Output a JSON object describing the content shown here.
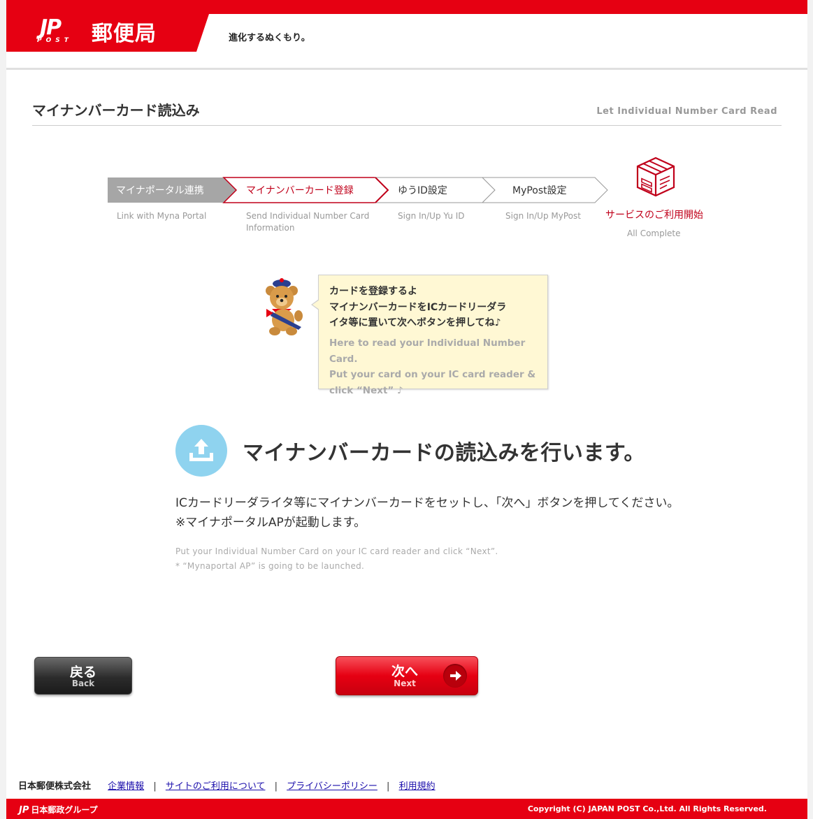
{
  "header": {
    "logo_jp": "JP",
    "logo_post": "POST",
    "brand": "郵便局",
    "tagline": "進化するぬくもり。"
  },
  "title": {
    "jp": "マイナンバーカード読込み",
    "en": "Let Individual Number Card Read"
  },
  "steps": [
    {
      "label": "マイナポータル連携",
      "sub": "Link with Myna Portal",
      "state": "done"
    },
    {
      "label": "マイナンバーカード登録",
      "sub": "Send Individual Number Card Information",
      "state": "current"
    },
    {
      "label": "ゆうID設定",
      "sub": "Sign In/Up Yu ID",
      "state": "pending"
    },
    {
      "label": "MyPost設定",
      "sub": "Sign In/Up MyPost",
      "state": "pending"
    }
  ],
  "final_step": {
    "label": "サービスのご利用開始",
    "sub": "All Complete"
  },
  "bubble": {
    "jp_line1": "カードを登録するよ",
    "jp_line2": "マイナンバーカードをICカードリーダラ",
    "jp_line3": "イタ等に置いて次へボタンを押してね♪",
    "en_line1": "Here to read your Individual Number Card.",
    "en_line2": "Put your card on your IC card reader &",
    "en_line3": "click “Next” ♪"
  },
  "main": {
    "heading": "マイナンバーカードの読込みを行います。",
    "desc_jp_line1": "ICカードリーダライタ等にマイナンバーカードをセットし、「次へ」ボタンを押してください。",
    "desc_jp_line2": "※マイナポータルAPが起動します。",
    "desc_en_line1": "Put your Individual Number Card on your IC card reader and click “Next”.",
    "desc_en_line2": "* “Mynaportal AP” is going to be launched."
  },
  "buttons": {
    "back_jp": "戻る",
    "back_en": "Back",
    "next_jp": "次へ",
    "next_en": "Next"
  },
  "footer": {
    "company": "日本郵便株式会社",
    "links": [
      "企業情報",
      "サイトのご利用について",
      "プライバシーポリシー",
      "利用規約"
    ],
    "separator": "|",
    "group_logo": "日本郵政グループ",
    "copyright": "Copyright (C) JAPAN POST Co.,Ltd.  All Rights Reserved."
  },
  "colors": {
    "brand_red": "#e60012",
    "done_step": "#a6a6a6",
    "accent_blue": "#8fd3ef",
    "bubble_bg": "#fff8d4"
  }
}
